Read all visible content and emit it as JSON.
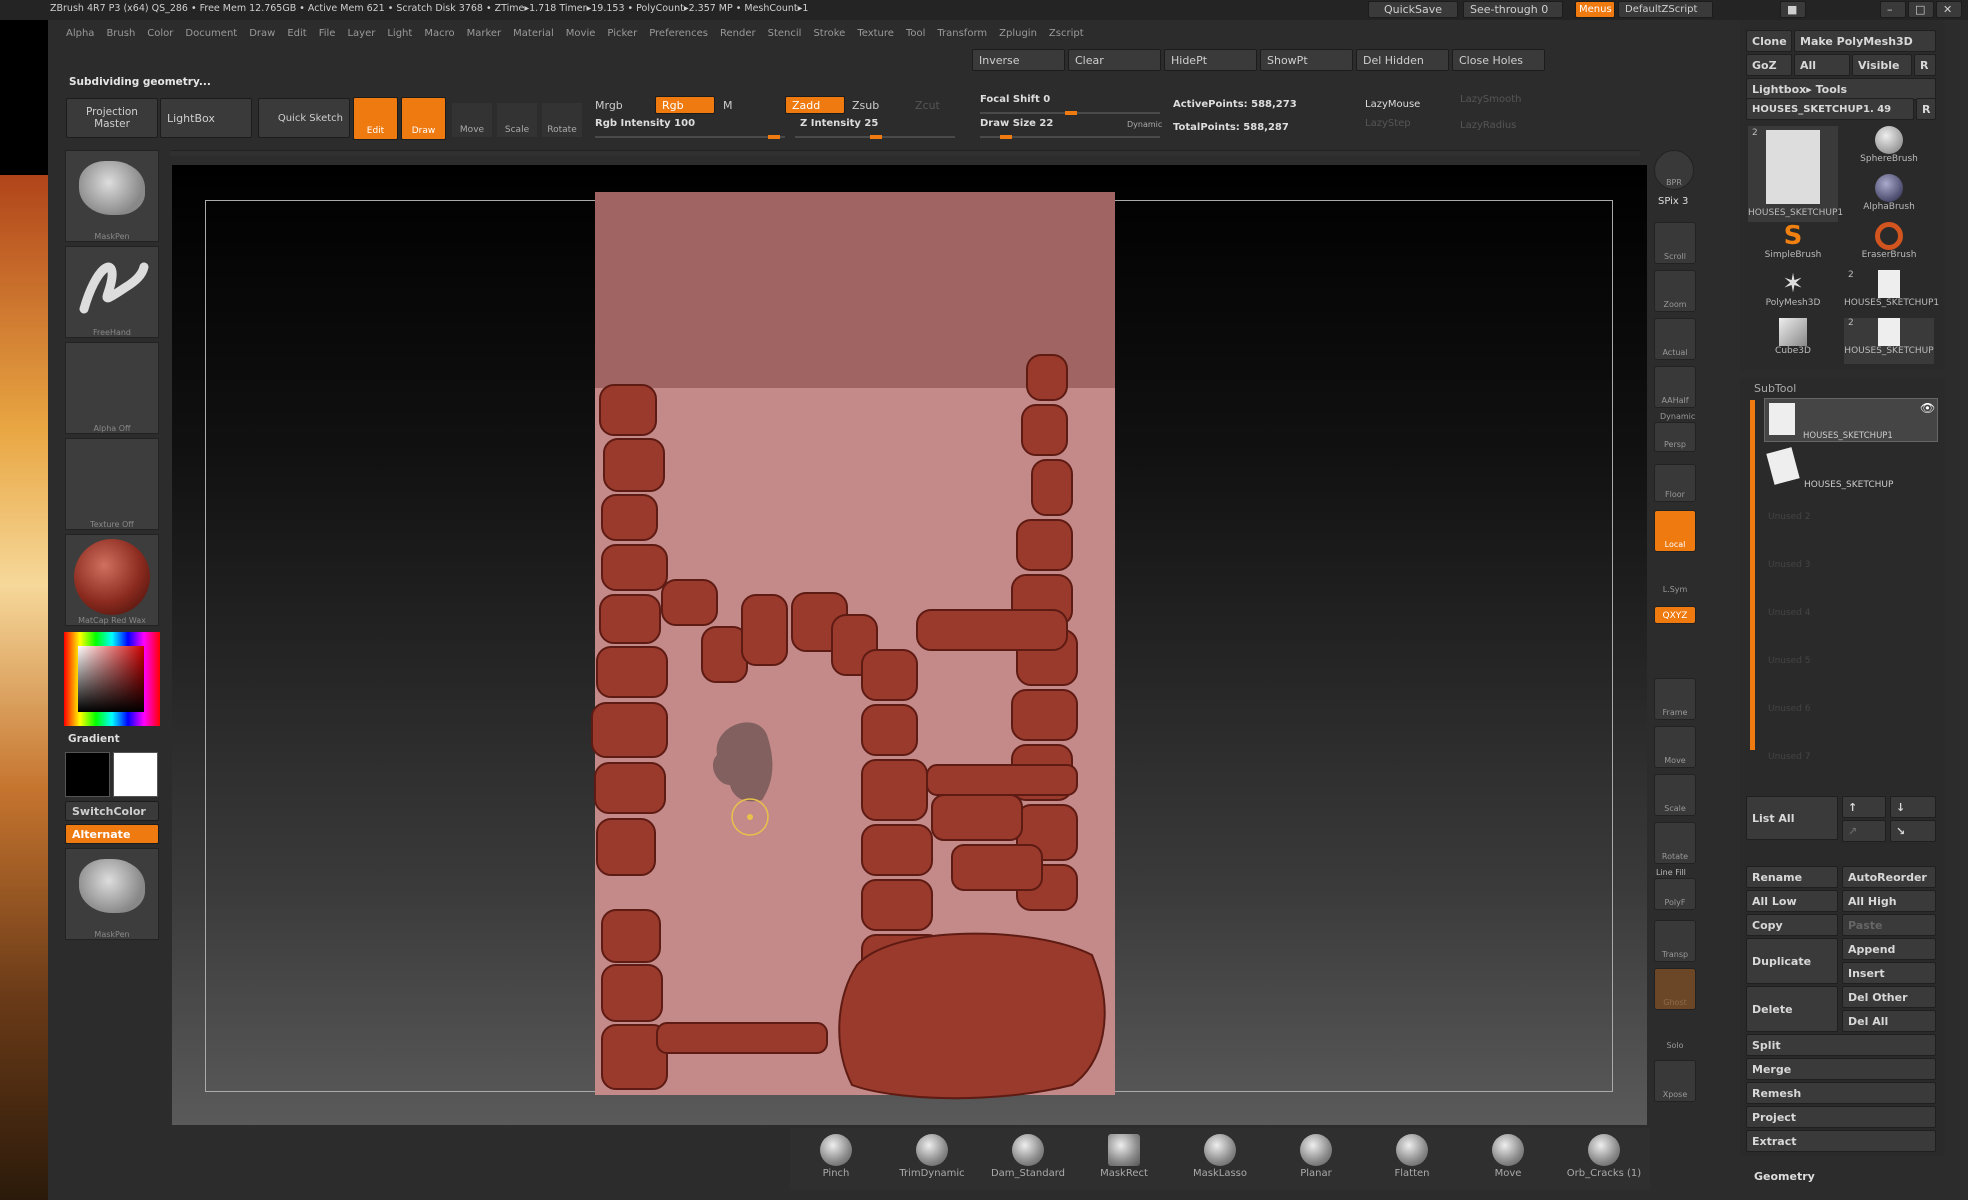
{
  "title_bar": {
    "text": "ZBrush 4R7 P3 (x64)   QS_286     • Free Mem 12.765GB • Active Mem 621 • Scratch Disk 3768 •  ZTime▸1.718 Timer▸19.153 • PolyCount▸2.357 MP • MeshCount▸1",
    "quicksave": "QuickSave",
    "see_through": "See-through  0",
    "menus": "Menus",
    "default_zscript": "DefaultZScript"
  },
  "menu_items": [
    "Alpha",
    "Brush",
    "Color",
    "Document",
    "Draw",
    "Edit",
    "File",
    "Layer",
    "Light",
    "Macro",
    "Marker",
    "Material",
    "Movie",
    "Picker",
    "Preferences",
    "Render",
    "Stencil",
    "Stroke",
    "Texture",
    "Tool",
    "Transform",
    "Zplugin",
    "Zscript"
  ],
  "status": "Subdividing geometry...",
  "mask_buttons": {
    "inverse": "Inverse",
    "clear": "Clear",
    "hidept": "HidePt",
    "showpt": "ShowPt",
    "del_hidden": "Del Hidden",
    "close_holes": "Close Holes"
  },
  "toolbar": {
    "projection_master": "Projection Master",
    "lightbox": "LightBox",
    "quick_sketch": "Quick Sketch",
    "edit": "Edit",
    "draw": "Draw",
    "move": "Move",
    "scale": "Scale",
    "rotate": "Rotate",
    "mrgb": "Mrgb",
    "rgb": "Rgb",
    "m": "M",
    "rgb_intensity": "Rgb Intensity 100",
    "zadd": "Zadd",
    "zsub": "Zsub",
    "zcut": "Zcut",
    "z_intensity": "Z Intensity 25",
    "focal_shift": "Focal Shift 0",
    "draw_size": "Draw Size 22",
    "dynamic": "Dynamic",
    "active_points": "ActivePoints: 588,273",
    "total_points": "TotalPoints: 588,287",
    "lazymouse": "LazyMouse",
    "lazysmooth": "LazySmooth",
    "lazystep": "LazyStep",
    "lazyradius": "LazyRadius"
  },
  "left_tools": {
    "maskpen": "MaskPen",
    "freehand": "FreeHand",
    "alpha_off": "Alpha  Off",
    "texture_off": "Texture  Off",
    "matcap": "MatCap Red Wax",
    "gradient": "Gradient",
    "switchcolor": "SwitchColor",
    "alternate": "Alternate",
    "maskpen2": "MaskPen"
  },
  "right_tools": {
    "bpr": "BPR",
    "spix": "SPix 3",
    "scroll": "Scroll",
    "zoom": "Zoom",
    "actual": "Actual",
    "aahalf": "AAHalf",
    "dynamic": "Dynamic",
    "persp": "Persp",
    "floor": "Floor",
    "local": "Local",
    "lsym": "L.Sym",
    "xyz": "QXYZ",
    "frame": "Frame",
    "move": "Move",
    "scale": "Scale",
    "rotate": "Rotate",
    "line_fill": "Line Fill",
    "polyf": "PolyF",
    "transp": "Transp",
    "ghost": "Ghost",
    "solo": "Solo",
    "xpose": "Xpose"
  },
  "tool_panel": {
    "clone": "Clone",
    "make_polymesh": "Make PolyMesh3D",
    "goz": "GoZ",
    "all": "All",
    "visible": "Visible",
    "r": "R",
    "lightbox_tools": "Lightbox▸ Tools",
    "current_tool": "HOUSES_SKETCHUP1. 49",
    "tools": [
      {
        "name": "HOUSES_SKETCHUP1",
        "count": "2"
      },
      {
        "name": "SphereBrush",
        "count": ""
      },
      {
        "name": "AlphaBrush",
        "count": ""
      },
      {
        "name": "SimpleBrush",
        "count": ""
      },
      {
        "name": "EraserBrush",
        "count": ""
      },
      {
        "name": "PolyMesh3D",
        "count": ""
      },
      {
        "name": "HOUSES_SKETCHUP1",
        "count": "2"
      },
      {
        "name": "Cube3D",
        "count": ""
      },
      {
        "name": "HOUSES_SKETCHUP",
        "count": "2"
      }
    ]
  },
  "subtool": {
    "header": "SubTool",
    "items": [
      "HOUSES_SKETCHUP1",
      "HOUSES_SKETCHUP"
    ],
    "unused": [
      "Unused  2",
      "Unused  3",
      "Unused  4",
      "Unused  5",
      "Unused  6",
      "Unused  7"
    ],
    "list_all": "List  All",
    "rename": "Rename",
    "autoreorder": "AutoReorder",
    "all_low": "All  Low",
    "all_high": "All  High",
    "copy": "Copy",
    "paste": "Paste",
    "duplicate": "Duplicate",
    "append": "Append",
    "insert": "Insert",
    "delete": "Delete",
    "del_other": "Del  Other",
    "del_all": "Del  All",
    "split": "Split",
    "merge": "Merge",
    "remesh": "Remesh",
    "project": "Project",
    "extract": "Extract",
    "geometry": "Geometry"
  },
  "brushes": [
    "Pinch",
    "TrimDynamic",
    "Dam_Standard",
    "MaskRect",
    "MaskLasso",
    "Planar",
    "Flatten",
    "Move",
    "Orb_Cracks (1)"
  ]
}
